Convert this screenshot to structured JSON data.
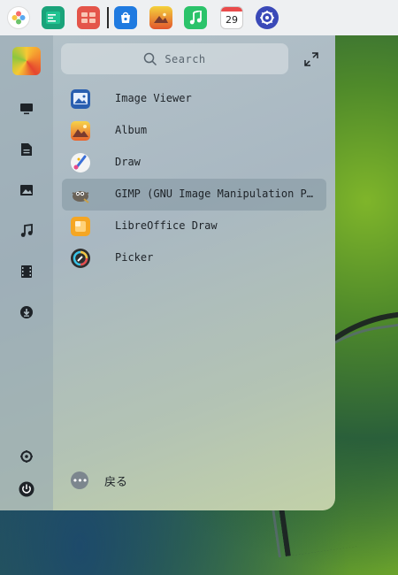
{
  "dock": {
    "items": [
      {
        "name": "launcher-dock-icon",
        "color": "#f0f0f0"
      },
      {
        "name": "terminal-dock-icon",
        "color": "#1aa37a"
      },
      {
        "name": "multitask-dock-icon",
        "color": "#e4554a"
      },
      {
        "name": "app-store-dock-icon",
        "color": "#1f7ae0"
      },
      {
        "name": "album-dock-icon",
        "color": "#f39a2b"
      },
      {
        "name": "music-dock-icon",
        "color": "#2bc36a"
      },
      {
        "name": "calendar-dock-icon",
        "color": "#ffffff"
      },
      {
        "name": "settings-dock-icon",
        "color": "#3a49b8"
      }
    ],
    "calendar_day": "29"
  },
  "sidebar": {
    "items": [
      {
        "name": "computer-icon"
      },
      {
        "name": "documents-icon"
      },
      {
        "name": "pictures-icon"
      },
      {
        "name": "music-icon"
      },
      {
        "name": "videos-icon"
      },
      {
        "name": "downloads-icon"
      }
    ],
    "bottom": [
      {
        "name": "settings-icon"
      },
      {
        "name": "power-icon"
      }
    ]
  },
  "search": {
    "placeholder": "Search"
  },
  "apps": [
    {
      "label": "Image Viewer",
      "icon": "image-viewer-icon",
      "color": "#2a5fb0"
    },
    {
      "label": "Album",
      "icon": "album-icon",
      "color": "#f29a33"
    },
    {
      "label": "Draw",
      "icon": "draw-icon",
      "color": "#f4f4f4"
    },
    {
      "label": "GIMP (GNU Image Manipulation Pr…",
      "icon": "gimp-icon",
      "color": "#6b6358"
    },
    {
      "label": "LibreOffice Draw",
      "icon": "libreoffice-draw-icon",
      "color": "#f5a623"
    },
    {
      "label": "Picker",
      "icon": "picker-icon",
      "color": "#2e2e2e"
    }
  ],
  "back": {
    "label": "戻る"
  }
}
